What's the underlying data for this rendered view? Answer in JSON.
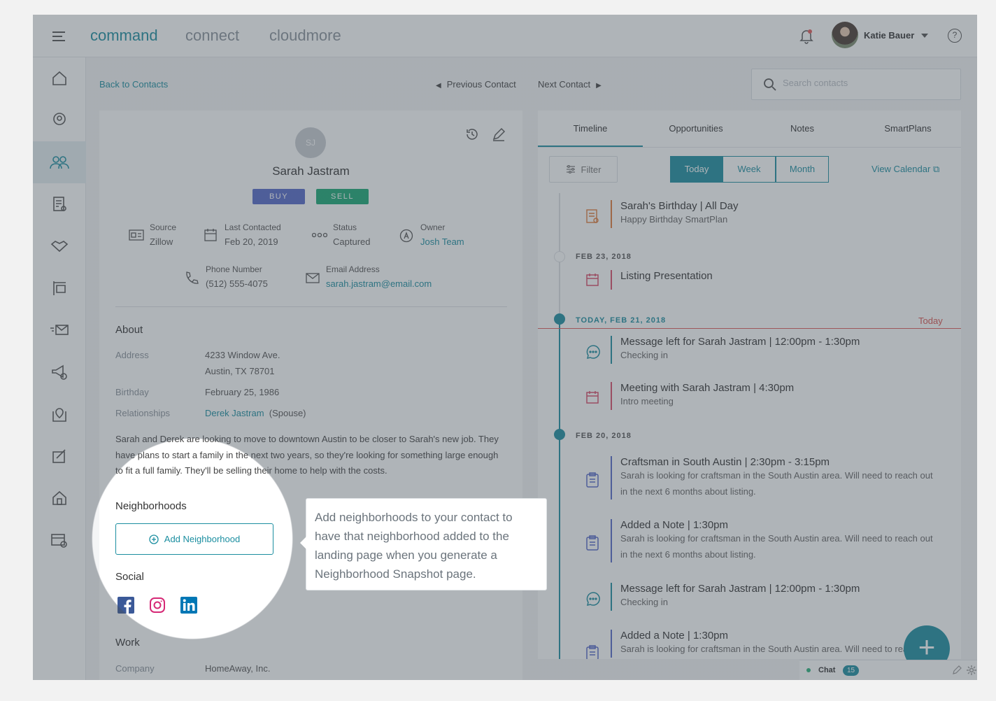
{
  "topbar": {
    "nav": [
      "command",
      "connect",
      "cloudmore"
    ],
    "user_name": "Katie Bauer"
  },
  "sidebar": {
    "items": [
      "home-icon",
      "pin-icon",
      "contacts-icon",
      "listing-icon",
      "handshake-icon",
      "sign-icon",
      "email-icon",
      "megaphone-icon",
      "map-pin-icon",
      "edit-icon",
      "house-icon",
      "calendar-icon"
    ]
  },
  "subnav": {
    "back": "Back to Contacts",
    "previous": "Previous Contact",
    "next": "Next Contact",
    "search_placeholder": "Search contacts"
  },
  "contact": {
    "initials": "SJ",
    "name": "Sarah Jastram",
    "tags": [
      {
        "label": "BUY",
        "color": "#5568c9"
      },
      {
        "label": "SELL",
        "color": "#19a974"
      }
    ],
    "source_label": "Source",
    "source": "Zillow",
    "last_contacted_label": "Last Contacted",
    "last_contacted": "Feb 20, 2019",
    "status_label": "Status",
    "status": "Captured",
    "owner_label": "Owner",
    "owner": "Josh Team",
    "phone_label": "Phone Number",
    "phone": "(512) 555-4075",
    "email_label": "Email Address",
    "email": "sarah.jastram@email.com"
  },
  "about": {
    "title": "About",
    "address_label": "Address",
    "address_line1": "4233 Window Ave.",
    "address_line2": "Austin, TX 78701",
    "birthday_label": "Birthday",
    "birthday": "February 25, 1986",
    "relationships_label": "Relationships",
    "relationship_name": "Derek Jastram",
    "relationship_type": "(Spouse)",
    "description": "Sarah and Derek are looking to move to downtown Austin to be closer to Sarah's new job. They have plans to start a family in the next two years, so they're looking for something large enough to fit a full family. They'll be selling their home to help with the costs."
  },
  "neighborhoods": {
    "title": "Neighborhoods",
    "add_label": "Add Neighborhood"
  },
  "social": {
    "title": "Social",
    "networks": [
      "facebook-icon",
      "instagram-icon",
      "linkedin-icon"
    ]
  },
  "work": {
    "title": "Work",
    "company_label": "Company",
    "company": "HomeAway, Inc."
  },
  "tooltip": {
    "text": "Add neighborhoods to your contact to have that neighborhood added to the landing page when you generate a Neighborhood Snapshot page."
  },
  "timeline": {
    "tabs": [
      "Timeline",
      "Opportunities",
      "Notes",
      "SmartPlans"
    ],
    "filter": "Filter",
    "ranges": [
      "Today",
      "Week",
      "Month"
    ],
    "view_calendar": "View Calendar",
    "today_label": "Today",
    "dates": [
      "FEB 23, 2018",
      "TODAY, FEB 21, 2018",
      "FEB 20, 2018"
    ],
    "events": [
      {
        "title": "Sarah's Birthday | All Day",
        "detail": "Happy Birthday SmartPlan"
      },
      {
        "title": "Listing Presentation",
        "detail": ""
      },
      {
        "title": "Message left for Sarah Jastram | 12:00pm - 1:30pm",
        "detail": "Checking in"
      },
      {
        "title": "Meeting with Sarah Jastram | 4:30pm",
        "detail": "Intro meeting"
      },
      {
        "title": "Craftsman in South Austin | 2:30pm - 3:15pm",
        "detail": "Sarah is looking for craftsman in the South Austin area. Will need to reach out in the next 6 months about listing."
      },
      {
        "title": "Added a Note | 1:30pm",
        "detail": "Sarah is looking for craftsman in the South Austin area. Will need to reach out in the next 6 months about listing."
      },
      {
        "title": "Message left for Sarah Jastram | 12:00pm - 1:30pm",
        "detail": "Checking in"
      },
      {
        "title": "Added a Note | 1:30pm",
        "detail": "Sarah is looking for craftsman in the South Austin area. Will need to reach"
      }
    ]
  },
  "chat": {
    "label": "Chat",
    "count": "15"
  },
  "colors": {
    "accent": "#1b8ea0",
    "today_line": "#e05a5a"
  }
}
